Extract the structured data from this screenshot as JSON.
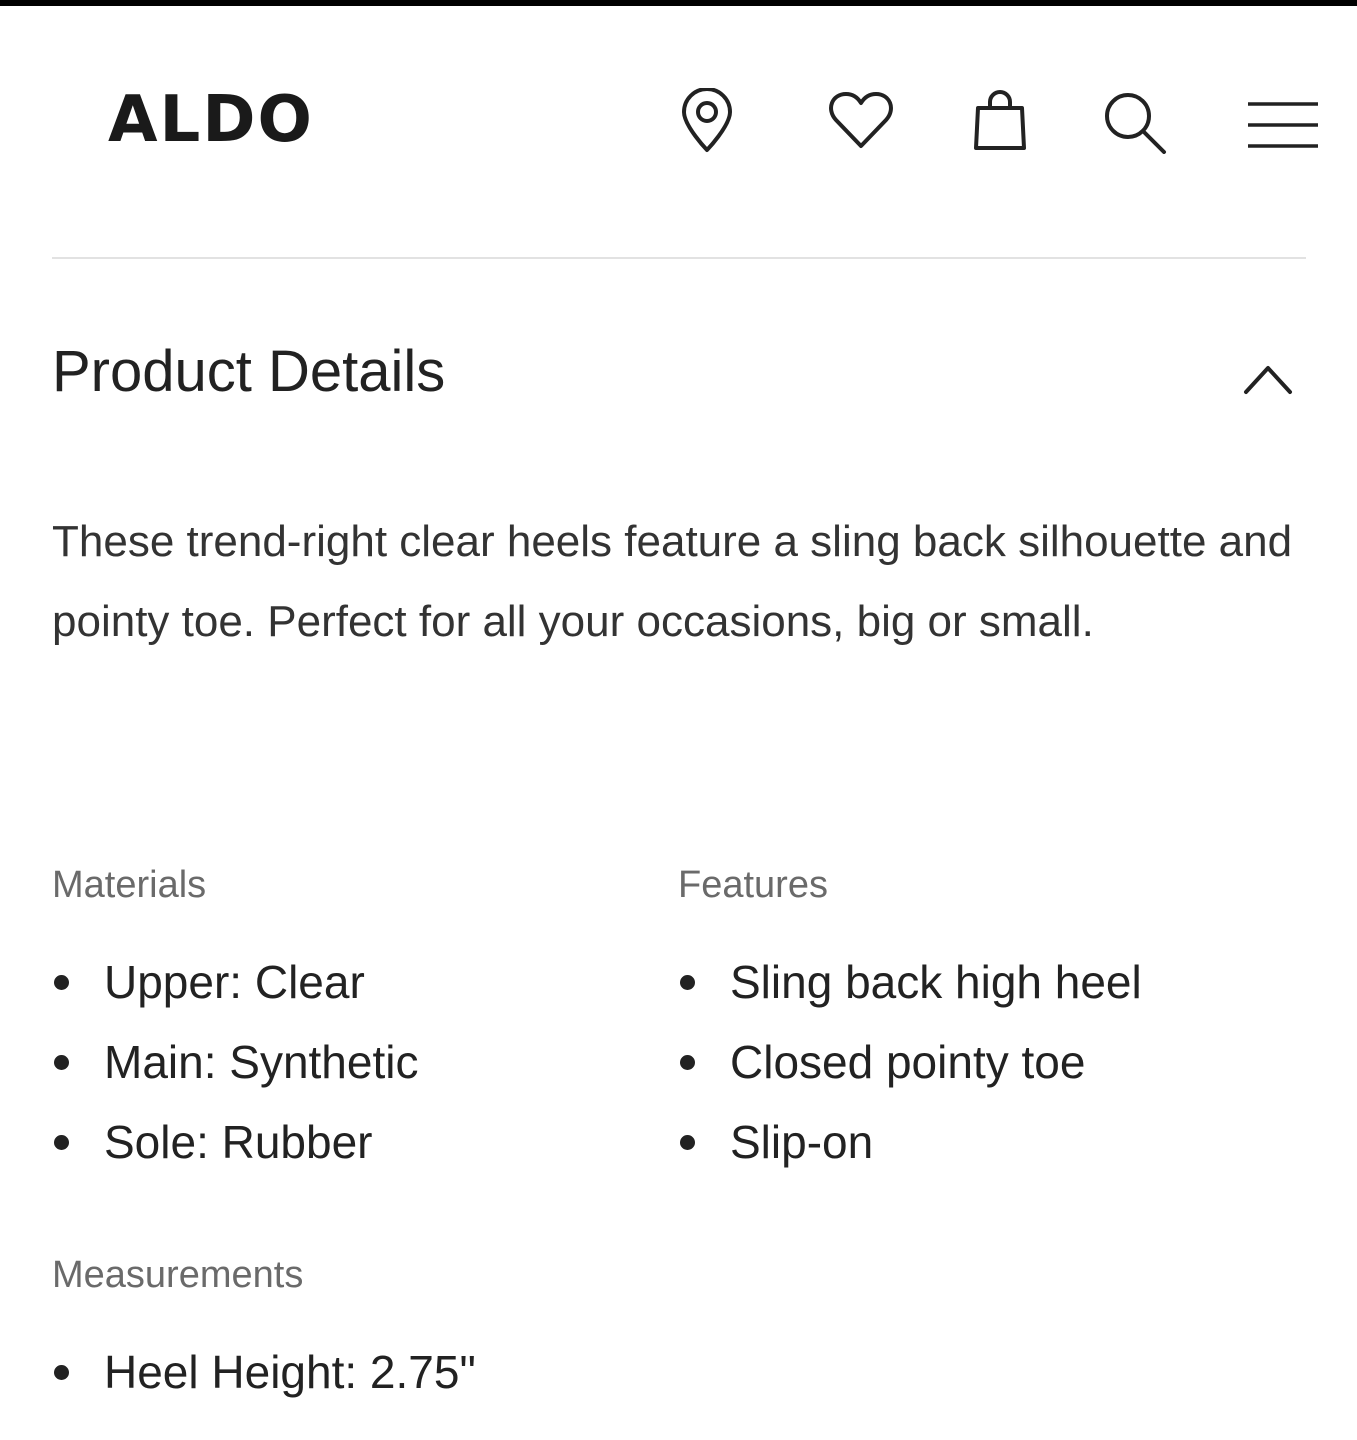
{
  "brand": {
    "logo_text": "ALDO"
  },
  "header": {
    "icons": [
      "location-pin-icon",
      "heart-icon",
      "shopping-bag-icon",
      "search-icon",
      "menu-icon"
    ]
  },
  "product_details": {
    "title": "Product Details",
    "expanded": true,
    "description": "These trend-right clear heels feature a sling back silhouette and pointy toe. Perfect for all your occasions, big or small.",
    "materials": {
      "heading": "Materials",
      "items": [
        "Upper: Clear",
        "Main: Synthetic",
        "Sole: Rubber"
      ]
    },
    "features": {
      "heading": "Features",
      "items": [
        "Sling back high heel",
        "Closed pointy toe",
        "Slip-on"
      ]
    },
    "measurements": {
      "heading": "Measurements",
      "items": [
        "Heel Height: 2.75\""
      ]
    }
  },
  "colors": {
    "text": "#222222",
    "muted": "#6a6a6a",
    "divider": "#e2e2e2",
    "top_bar": "#000000"
  }
}
